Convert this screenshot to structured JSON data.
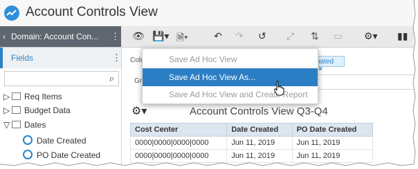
{
  "window": {
    "title": "Account Controls View"
  },
  "domain": {
    "label": "Domain: Account Con..."
  },
  "toolbar_icons": [
    "eye-icon",
    "save-icon",
    "export-icon",
    "undo-icon",
    "redo-icon",
    "revert-icon",
    "chart-icon",
    "sort-icon",
    "layout-icon",
    "gear-icon",
    "bar-chart-icon"
  ],
  "left_panel": {
    "header": "Fields",
    "search": {
      "placeholder": "",
      "icon": "search-icon"
    },
    "tree": [
      {
        "label": "Req Items",
        "expanded": false
      },
      {
        "label": "Budget Data",
        "expanded": false
      },
      {
        "label": "Dates",
        "expanded": true,
        "children": [
          "Date Created",
          "PO Date Created"
        ]
      }
    ]
  },
  "workarea": {
    "columns_label": "Colum",
    "group_label": "Grou",
    "chip_text": "nated",
    "report_title": "Account Controls View Q3-Q4"
  },
  "table": {
    "headers": [
      "Cost Center",
      "Date Created",
      "PO Date Created"
    ],
    "rows": [
      [
        "0000|0000|0000|0000",
        "Jun 11, 2019",
        "Jun 11, 2019"
      ],
      [
        "0000|0000|0000|0000",
        "Jun 11, 2019",
        "Jun 11, 2019"
      ]
    ]
  },
  "menu": {
    "items": [
      {
        "label": "Save Ad Hoc View",
        "state": "disabled"
      },
      {
        "label": "Save Ad Hoc View As...",
        "state": "active"
      },
      {
        "label": "Save Ad Hoc View and Create Report",
        "state": "disabled"
      }
    ]
  },
  "colors": {
    "accent": "#2b83c6",
    "menu_active": "#2c7ec4",
    "domain_bg": "#5f6670"
  }
}
